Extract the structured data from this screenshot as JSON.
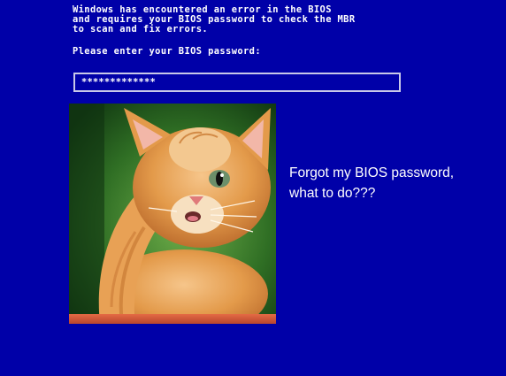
{
  "screen": {
    "background_color": "#0000a8",
    "text_color": "#ffffff"
  },
  "error_message": {
    "lines": [
      "Windows has encountered an error in the BIOS",
      "and requires your BIOS password to check the MBR",
      "to scan and fix errors."
    ]
  },
  "password_prompt": {
    "label": "Please enter your BIOS password:",
    "value": "*************"
  },
  "kitten_image": {
    "subject": "orange tabby kitten covering its face with a paw",
    "colors": {
      "fur": "#e0913d",
      "background": "#2c6a22",
      "box": "#d1583a"
    }
  },
  "caption": {
    "line1": "Forgot my BIOS password,",
    "line2": "what to do???"
  }
}
